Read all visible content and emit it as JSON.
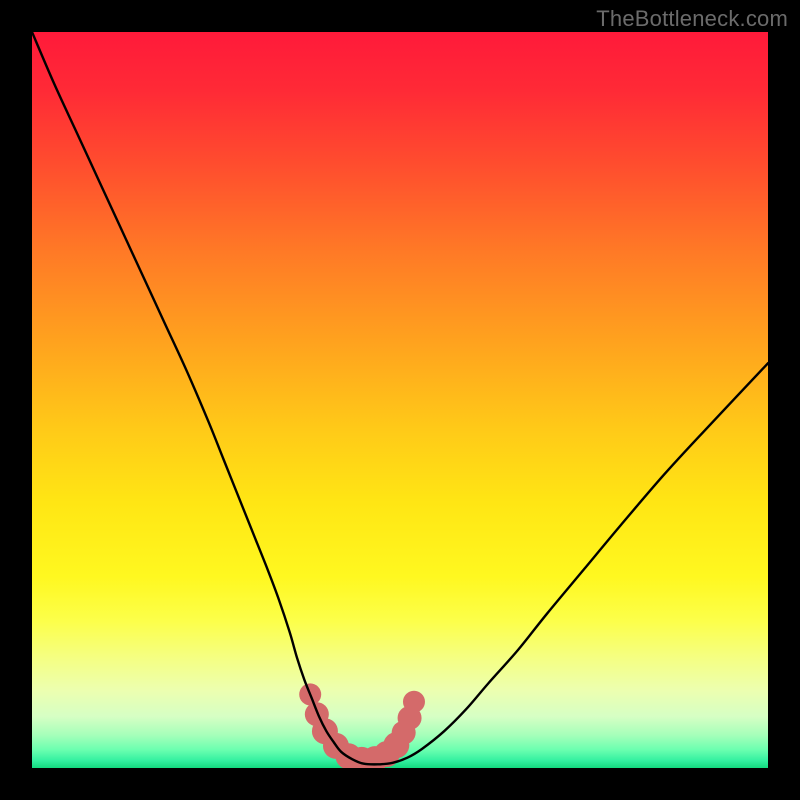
{
  "watermark": "TheBottleneck.com",
  "gradient": {
    "stops": [
      {
        "offset": 0.0,
        "color": "#ff1a3a"
      },
      {
        "offset": 0.08,
        "color": "#ff2a36"
      },
      {
        "offset": 0.18,
        "color": "#ff4d2e"
      },
      {
        "offset": 0.3,
        "color": "#ff7a26"
      },
      {
        "offset": 0.42,
        "color": "#ffa21e"
      },
      {
        "offset": 0.54,
        "color": "#ffca18"
      },
      {
        "offset": 0.64,
        "color": "#ffe614"
      },
      {
        "offset": 0.74,
        "color": "#fff820"
      },
      {
        "offset": 0.8,
        "color": "#fcff4a"
      },
      {
        "offset": 0.85,
        "color": "#f5ff82"
      },
      {
        "offset": 0.895,
        "color": "#ecffb0"
      },
      {
        "offset": 0.93,
        "color": "#d6ffc4"
      },
      {
        "offset": 0.955,
        "color": "#a6ffba"
      },
      {
        "offset": 0.975,
        "color": "#6cffb0"
      },
      {
        "offset": 0.99,
        "color": "#33f0a0"
      },
      {
        "offset": 1.0,
        "color": "#14d97f"
      }
    ]
  },
  "chart_data": {
    "type": "line",
    "title": "",
    "xlabel": "",
    "ylabel": "",
    "xlim": [
      0,
      100
    ],
    "ylim": [
      0,
      100
    ],
    "series": [
      {
        "name": "bottleneck-curve",
        "x": [
          0,
          3,
          6,
          9,
          12,
          15,
          18,
          21,
          24,
          26,
          28,
          30,
          32,
          33.5,
          35,
          36,
          37,
          38,
          39,
          40,
          41,
          42,
          43.5,
          45,
          47,
          49,
          51,
          53,
          56,
          59,
          62,
          66,
          70,
          75,
          80,
          86,
          92,
          100
        ],
        "y": [
          100,
          93,
          86.5,
          80,
          73.5,
          67,
          60.5,
          54,
          47,
          42,
          37,
          32,
          27,
          23,
          18.5,
          15,
          12,
          9.5,
          7,
          5,
          3.5,
          2.2,
          1.2,
          0.6,
          0.5,
          0.7,
          1.4,
          2.6,
          5,
          8,
          11.5,
          16,
          21,
          27,
          33,
          40,
          46.5,
          55
        ]
      }
    ],
    "markers": {
      "name": "trough-markers",
      "color": "#d46a6a",
      "x": [
        37.8,
        38.7,
        39.8,
        41.3,
        43.0,
        44.8,
        46.6,
        48.2,
        49.5,
        50.5,
        51.3,
        51.9
      ],
      "y": [
        10.0,
        7.3,
        5.0,
        3.0,
        1.6,
        1.1,
        1.2,
        1.9,
        3.1,
        4.8,
        6.8,
        9.0
      ],
      "r": [
        11,
        12,
        13,
        13,
        13,
        13,
        13,
        13,
        13,
        12,
        12,
        11
      ]
    }
  }
}
